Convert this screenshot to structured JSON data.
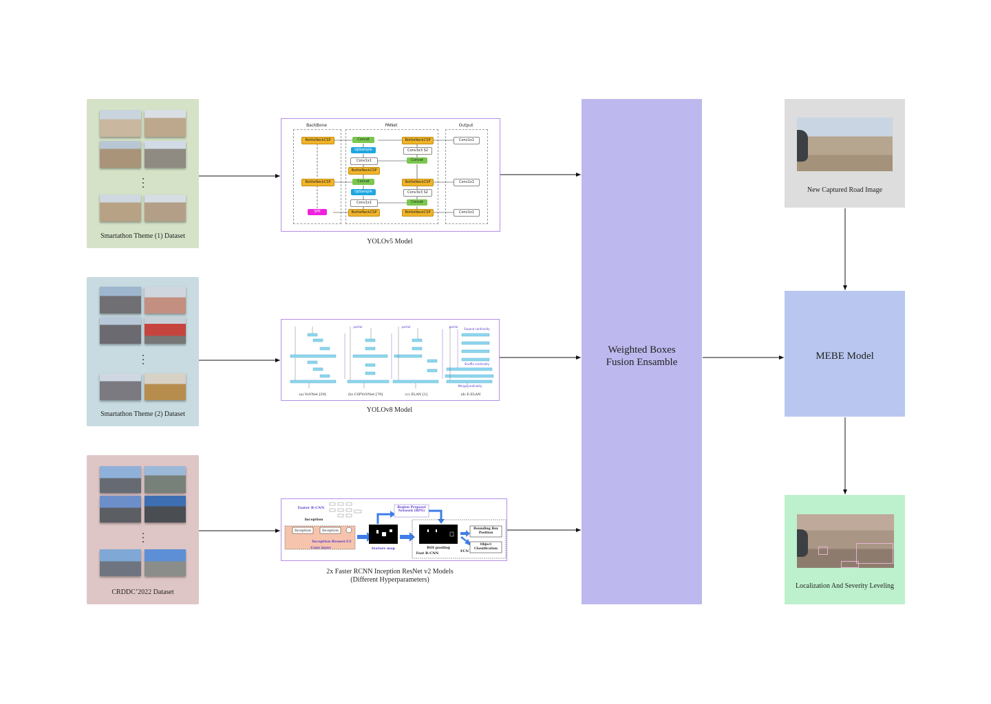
{
  "datasets": [
    {
      "label": "Smartathon Theme (1) Dataset",
      "color": "#d5e2c7"
    },
    {
      "label": "Smartathon Theme (2) Dataset",
      "color": "#c7dbe0"
    },
    {
      "label": "CRDDC’2022 Dataset",
      "color": "#dfc6c6"
    }
  ],
  "yolov5": {
    "caption": "YOLOv5 Model",
    "sections": {
      "backbone": "BackBone",
      "panet": "PANet",
      "output": "Output"
    },
    "nodes": {
      "bottleneck": "BottleNeckCSP",
      "concat": "Concat",
      "upsample": "UpSample",
      "conv1": "Conv1x1",
      "conv3": "Conv3x3 S2",
      "spp": "SPP"
    }
  },
  "yolov8": {
    "caption": "YOLOv8 Model",
    "subcaptions": [
      "(a) VoVNet [39]",
      "(b) CSPVoVNet [79]",
      "(c) ELAN [1]",
      "(d) E-ELAN"
    ],
    "labels": {
      "partial": "partial",
      "expand": "Expand cardinality",
      "shuffle": "Shuffle cardinality",
      "merge": "Merge cardinality"
    }
  },
  "frcnn": {
    "caption_line1": "2x Faster RCNN Inception ResNet v2 Models",
    "caption_line2": "(Different Hyperparameters)",
    "labels": {
      "title": "Faster R-CNN",
      "inception": "Inception",
      "inception_resnet": "Inception-Resnet-V2",
      "conv_layer": "Conv layer",
      "rpn": "Region Proposal Network (RPN)",
      "feature_map": "feature map",
      "roi_pooling": "ROI pooling",
      "fast_rcnn": "Fast R-CNN",
      "fcn": "FCN",
      "bbox": "Bounding Box Position",
      "classification": "Object Classification"
    }
  },
  "fusion": {
    "line1": "Weighted Boxes",
    "line2": "Fusion Ensamble",
    "color": "#bdb8ed"
  },
  "right": {
    "input_label": "New Captured Road Image",
    "input_color": "#dddddd",
    "mebe_label": "MEBE Model",
    "mebe_color": "#b9c7f0",
    "output_label": "Localization And Severity Leveling",
    "output_color": "#bdf0cc"
  }
}
